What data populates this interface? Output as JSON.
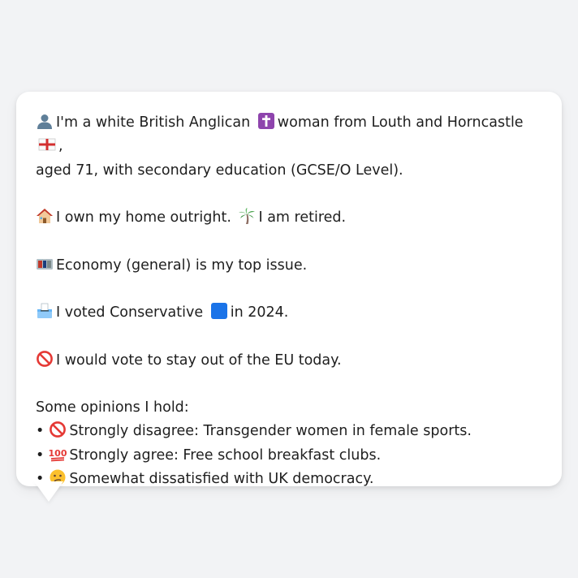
{
  "persona": {
    "intro_part1": "I'm a white British Anglican",
    "intro_part2": "woman from Louth and Horncastle",
    "intro_part3": ",",
    "intro_line2": "aged 71, with secondary education (GCSE/O Level).",
    "home_text": "I own my home outright.",
    "work_text": "I am retired.",
    "issue_text": "Economy (general) is my top issue.",
    "vote_part1": "I voted Conservative",
    "vote_part2": "in 2024.",
    "eu_text": "I would vote to stay out of the EU today.",
    "opinions_heading": "Some opinions I hold:",
    "opinions": [
      {
        "bullet": "•",
        "text": "Strongly disagree: Transgender women in female sports.",
        "icon": "no-entry-icon"
      },
      {
        "bullet": "•",
        "text": "Strongly agree: Free school breakfast clubs.",
        "icon": "hundred-points-icon"
      },
      {
        "bullet": "•",
        "text": "Somewhat dissatisfied with UK democracy.",
        "icon": "confused-face-icon"
      }
    ]
  },
  "colors": {
    "background": "#f2f3f5",
    "card": "#ffffff",
    "text": "#1e1e1e",
    "cross_badge": "#8e44ad",
    "conservative_blue": "#1a73e8",
    "no_entry_red": "#e53935"
  }
}
